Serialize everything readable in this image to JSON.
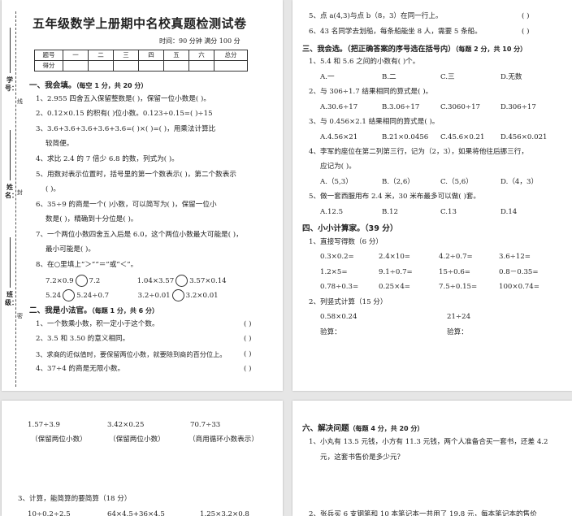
{
  "page1": {
    "title": "五年级数学上册期中名校真题检测试卷",
    "meta": "时间：90 分钟    满分 100 分",
    "margin": {
      "xuehao": "学号：",
      "xian": "线",
      "xingming": "姓名：",
      "feng": "封",
      "banji": "班级：",
      "mi": "密"
    },
    "score_table": {
      "header": [
        "题号",
        "一",
        "二",
        "三",
        "四",
        "五",
        "六",
        "总分"
      ],
      "row_label": "得分"
    },
    "sec1": {
      "title": "一、我会填。",
      "note": "（每空 1 分，共 20 分）"
    },
    "sec1_lines": [
      "1、2.955 四舍五入保留整数是(       )，保留一位小数是(       )。",
      "2、0.12×0.15 的积有(       )位小数。0.123÷0.15=(       )÷15",
      "3、3.6+3.6+3.6+3.6+3.6=(       )×(       )=(       )，用乘法计算比",
      "较简便。",
      "4、求比 2.4 的 7 倍少 6.8 的数，列式为(                          )。",
      "5、用数对表示位置时，括号里的第一个数表示(       )，第二个数表示",
      "(       )。",
      "6、35÷9 的商是一个(       )小数，可以简写为(       )，保留一位小",
      "数是(       )，精确到十分位是(       )。",
      "7、一个两位小数四舍五入后是 6.0，这个两位小数最大可能是(       )，",
      "最小可能是(       )。",
      "8、在○里填上“＞”“＝”或“＜”。"
    ],
    "compare": [
      [
        "7.2×0.9",
        "7.2",
        "1.04×3.57",
        "3.57×0.14"
      ],
      [
        "5.24",
        "5.24÷0.7",
        "3.2÷0.01",
        "3.2×0.01"
      ]
    ],
    "sec2": {
      "title": "二、我是小法官。",
      "note": "（每题 1 分，共 6 分）"
    },
    "sec2_lines": [
      "1、一个数乘小数，积一定小于这个数。",
      "2、3.5 和 3.50 的意义相同。",
      "3、求商的近似值时，要保留两位小数，就要除到商的百分位上。",
      "4、37÷4 的商是无限小数。"
    ],
    "paren": "(       )"
  },
  "page2": {
    "lines_top": [
      "5、点 a(4,3)与点 b（8，3）在同一行上。",
      "6、43 名同学去划船，每条船能坐 8 人，需要 5 条船。"
    ],
    "sec3": {
      "title": "三、我会选。（把正确答案的序号选在括号内）",
      "note": "（每题 2 分，共 10 分）"
    },
    "q1": "1、5.4 和 5.6 之间的小数有(       )个。",
    "q1_opts": [
      "A.一",
      "B.二",
      "C.三",
      "D.无数"
    ],
    "q2": "2、与 306÷1.7 结果相同的算式是(       )。",
    "q2_opts": [
      "A.30.6÷17",
      "B.3.06÷17",
      "C.3060÷17",
      "D.306÷17"
    ],
    "q3": "3、与 0.456×2.1 结果相同的算式是(       )。",
    "q3_opts": [
      "A.4.56×21",
      "B.21×0.0456",
      "C.45.6×0.21",
      "D.456×0.021"
    ],
    "q4": "4、李军的座位在第二列第三行，记为（2，3），如果将他往后挪三行，",
    "q4b": "应记为(       )。",
    "q4_opts": [
      "A.（5,3）",
      "B.（2,6）",
      "C.（5,6）",
      "D.（4，3）"
    ],
    "q5": "5、做一套西服用布 2.4 米，30 米布最多可以做(       )套。",
    "q5_opts": [
      "A.12.5",
      "B.12",
      "C.13",
      "D.14"
    ],
    "sec4": {
      "title": "四、小小计算家。",
      "note": "（39 分）"
    },
    "s1": "1、直接写得数（6 分）",
    "direct": [
      [
        "0.3×0.2=",
        "2.4×10=",
        "4.2÷0.7=",
        "3.6÷12="
      ],
      [
        "1.2×5=",
        "9.1÷0.7=",
        "15÷0.6=",
        "0.8－0.35="
      ],
      [
        "0.78÷0.3=",
        "0.25×4=",
        "7.5÷0.15=",
        "100×0.74="
      ]
    ],
    "s2": "2、列竖式计算（15 分）",
    "vert": [
      "0.58×0.24",
      "21÷24"
    ],
    "check": [
      "验算：",
      "验算："
    ]
  },
  "page3": {
    "calc": [
      "1.57÷3.9",
      "3.42×0.25",
      "70.7÷33"
    ],
    "notes": [
      "（保留两位小数）",
      "（保留两位小数）",
      "（商用循环小数表示）"
    ],
    "s3": "3、计算，能简算的要简算（18 分）",
    "partial": [
      "10÷0.2÷2.5",
      "64×4.5+36×4.5",
      "1.25×3.2×0.8"
    ]
  },
  "page4": {
    "sec6": {
      "title": "六、解决问题",
      "note": "（每题 4 分，共 20 分）"
    },
    "p1a": "1、小丸有 13.5 元钱，小方有 11.3 元钱，两个人准备合买一套书，还差 4.2",
    "p1b": "元，这套书售价是多少元？",
    "p2": "2、张兵买 6 支钢笔和 10 本笔记本一共用了 19.8 元，每本笔记本的售价"
  }
}
